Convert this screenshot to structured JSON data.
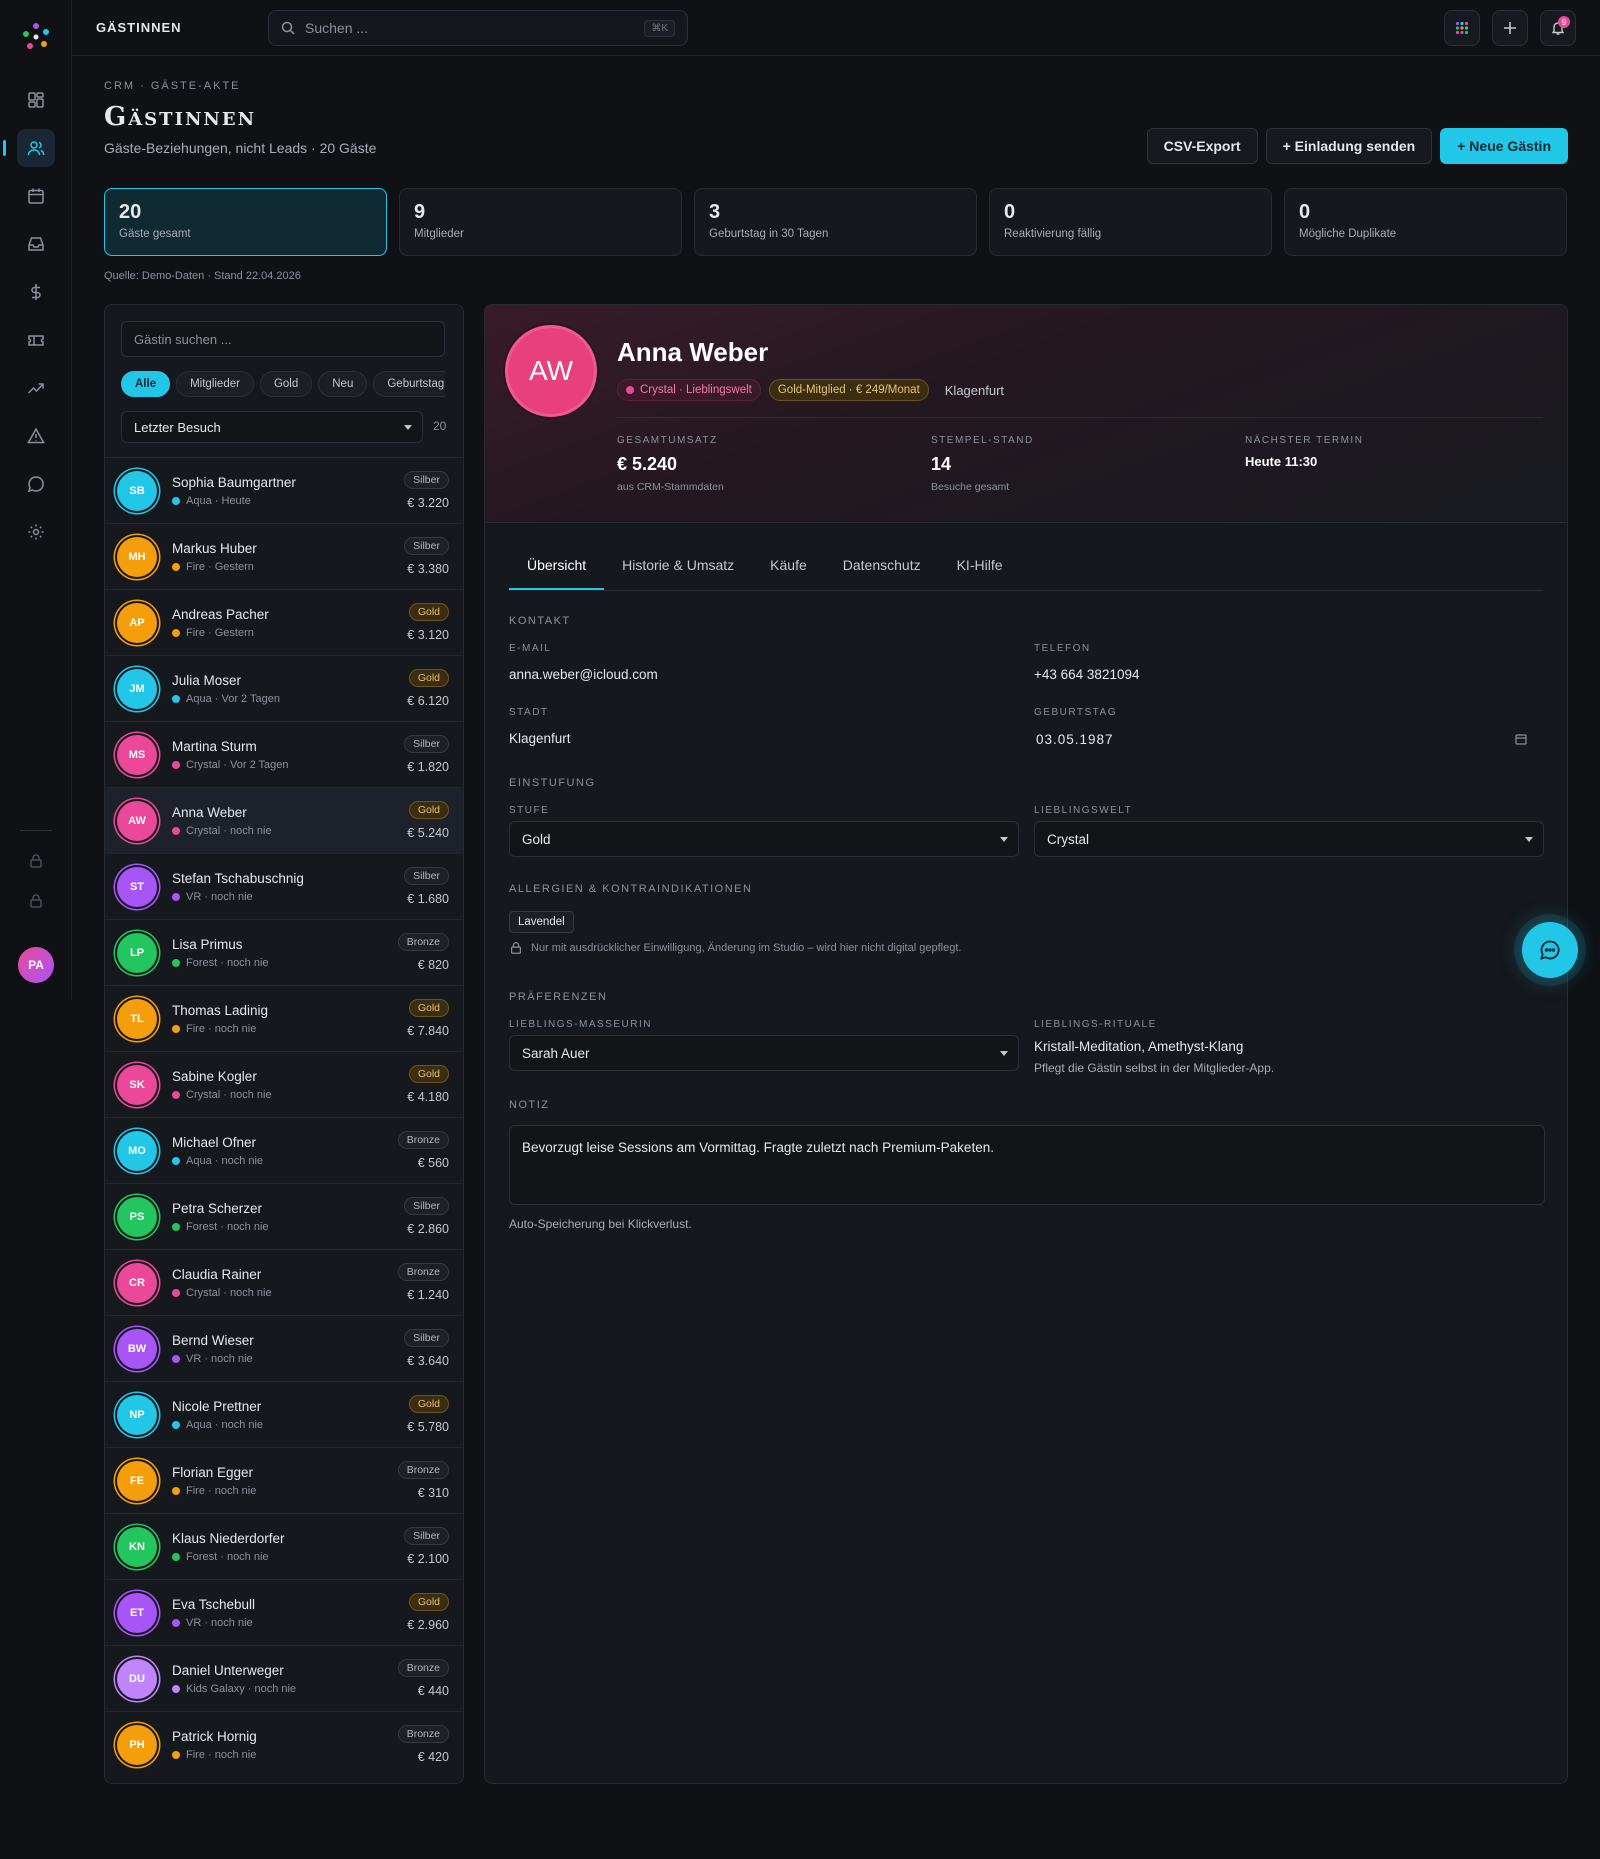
{
  "app": {
    "brand": "GÄSTINNEN"
  },
  "topbar": {
    "search_placeholder": "Suchen ...",
    "search_kbd": "⌘K",
    "notif_count": "9"
  },
  "header": {
    "breadcrumb": "CRM · GÄSTE-AKTE",
    "title": "Gästinnen",
    "subtitle": "Gäste-Beziehungen, nicht Leads · 20 Gäste",
    "actions": {
      "export": "CSV-Export",
      "invite": "+ Einladung senden",
      "new": "+ Neue Gästin"
    }
  },
  "kpis": [
    {
      "value": "20",
      "label": "Gäste gesamt"
    },
    {
      "value": "9",
      "label": "Mitglieder"
    },
    {
      "value": "3",
      "label": "Geburtstag in 30 Tagen"
    },
    {
      "value": "0",
      "label": "Reaktivierung fällig"
    },
    {
      "value": "0",
      "label": "Mögliche Duplikate"
    }
  ],
  "source": "Quelle: Demo-Daten · Stand 22.04.2026",
  "list": {
    "search_placeholder": "Gästin suchen ...",
    "chips": [
      "Alle",
      "Mitglieder",
      "Gold",
      "Neu",
      "Geburtstag bald"
    ],
    "sort": "Letzter Besuch",
    "count": "20",
    "guests": [
      {
        "initials": "SB",
        "name": "Sophia Baumgartner",
        "meta": "Aqua · Heute",
        "world": "aqua",
        "tier": "Silber",
        "amount": "€ 3.220"
      },
      {
        "initials": "MH",
        "name": "Markus Huber",
        "meta": "Fire · Gestern",
        "world": "fire",
        "tier": "Silber",
        "amount": "€ 3.380"
      },
      {
        "initials": "AP",
        "name": "Andreas Pacher",
        "meta": "Fire · Gestern",
        "world": "fire",
        "tier": "Gold",
        "amount": "€ 3.120"
      },
      {
        "initials": "JM",
        "name": "Julia Moser",
        "meta": "Aqua · Vor 2 Tagen",
        "world": "aqua",
        "tier": "Gold",
        "amount": "€ 6.120"
      },
      {
        "initials": "MS",
        "name": "Martina Sturm",
        "meta": "Crystal · Vor 2 Tagen",
        "world": "crystal",
        "tier": "Silber",
        "amount": "€ 1.820"
      },
      {
        "initials": "AW",
        "name": "Anna Weber",
        "meta": "Crystal · noch nie",
        "world": "crystal",
        "tier": "Gold",
        "amount": "€ 5.240"
      },
      {
        "initials": "ST",
        "name": "Stefan Tschabuschnig",
        "meta": "VR · noch nie",
        "world": "vr",
        "tier": "Silber",
        "amount": "€ 1.680"
      },
      {
        "initials": "LP",
        "name": "Lisa Primus",
        "meta": "Forest · noch nie",
        "world": "forest",
        "tier": "Bronze",
        "amount": "€ 820"
      },
      {
        "initials": "TL",
        "name": "Thomas Ladinig",
        "meta": "Fire · noch nie",
        "world": "fire",
        "tier": "Gold",
        "amount": "€ 7.840"
      },
      {
        "initials": "SK",
        "name": "Sabine Kogler",
        "meta": "Crystal · noch nie",
        "world": "crystal",
        "tier": "Gold",
        "amount": "€ 4.180"
      },
      {
        "initials": "MO",
        "name": "Michael Ofner",
        "meta": "Aqua · noch nie",
        "world": "aqua",
        "tier": "Bronze",
        "amount": "€ 560"
      },
      {
        "initials": "PS",
        "name": "Petra Scherzer",
        "meta": "Forest · noch nie",
        "world": "forest",
        "tier": "Silber",
        "amount": "€ 2.860"
      },
      {
        "initials": "CR",
        "name": "Claudia Rainer",
        "meta": "Crystal · noch nie",
        "world": "crystal",
        "tier": "Bronze",
        "amount": "€ 1.240"
      },
      {
        "initials": "BW",
        "name": "Bernd Wieser",
        "meta": "VR · noch nie",
        "world": "vr",
        "tier": "Silber",
        "amount": "€ 3.640"
      },
      {
        "initials": "NP",
        "name": "Nicole Prettner",
        "meta": "Aqua · noch nie",
        "world": "aqua",
        "tier": "Gold",
        "amount": "€ 5.780"
      },
      {
        "initials": "FE",
        "name": "Florian Egger",
        "meta": "Fire · noch nie",
        "world": "fire",
        "tier": "Bronze",
        "amount": "€ 310"
      },
      {
        "initials": "KN",
        "name": "Klaus Niederdorfer",
        "meta": "Forest · noch nie",
        "world": "forest",
        "tier": "Silber",
        "amount": "€ 2.100"
      },
      {
        "initials": "ET",
        "name": "Eva Tschebull",
        "meta": "VR · noch nie",
        "world": "vr",
        "tier": "Gold",
        "amount": "€ 2.960"
      },
      {
        "initials": "DU",
        "name": "Daniel Unterweger",
        "meta": "Kids Galaxy · noch nie",
        "world": "galaxy",
        "tier": "Bronze",
        "amount": "€ 440"
      },
      {
        "initials": "PH",
        "name": "Patrick Hornig",
        "meta": "Fire · noch nie",
        "world": "fire",
        "tier": "Bronze",
        "amount": "€ 420"
      }
    ]
  },
  "worlds": {
    "aqua": "#22c7e8",
    "fire": "#f59e0b",
    "crystal": "#ec4899",
    "vr": "#a855f7",
    "forest": "#22c55e",
    "galaxy": "#c084fc"
  },
  "detail": {
    "initials": "AW",
    "name": "Anna Weber",
    "tag_world": "Crystal · Lieblingswelt",
    "tag_member": "Gold-Mitglied · € 249/Monat",
    "city": "Klagenfurt",
    "stats": [
      {
        "key": "GESAMTUMSATZ",
        "value": "€ 5.240",
        "sub": "aus CRM-Stammdaten"
      },
      {
        "key": "STEMPEL-STAND",
        "value": "14",
        "sub": "Besuche gesamt"
      },
      {
        "key": "NÄCHSTER TERMIN",
        "value": "Heute 11:30",
        "sub": ""
      }
    ],
    "tabs": [
      "Übersicht",
      "Historie & Umsatz",
      "Käufe",
      "Datenschutz",
      "KI-Hilfe"
    ],
    "sections": {
      "contact": "KONTAKT",
      "rating": "EINSTUFUNG",
      "allergies": "ALLERGIEN & KONTRAINDIKATIONEN",
      "prefs": "PRÄFERENZEN",
      "note": "NOTIZ"
    },
    "contact": {
      "email_label": "E-MAIL",
      "email": "anna.weber@icloud.com",
      "phone_label": "TELEFON",
      "phone": "+43 664 3821094",
      "city_label": "STADT",
      "city": "Klagenfurt",
      "birthday_label": "GEBURTSTAG",
      "birthday": "03.05.1987"
    },
    "rating": {
      "tier_label": "STUFE",
      "tier": "Gold",
      "world_label": "LIEBLINGSWELT",
      "world": "Crystal"
    },
    "allergy": "Lavendel",
    "allergy_note": "Nur mit ausdrücklicher Einwilligung, Änderung im Studio – wird hier nicht digital gepflegt.",
    "prefs": {
      "masseur_label": "LIEBLINGS-MASSEURIN",
      "masseur": "Sarah Auer",
      "rituals_label": "LIEBLINGS-RITUALE",
      "rituals": "Kristall-Meditation, Amethyst-Klang",
      "rituals_hint": "Pflegt die Gästin selbst in der Mitglieder-App."
    },
    "note": "Bevorzugt leise Sessions am Vormittag. Fragte zuletzt nach Premium-Paketen.",
    "autosave": "Auto-Speicherung bei Klickverlust."
  }
}
